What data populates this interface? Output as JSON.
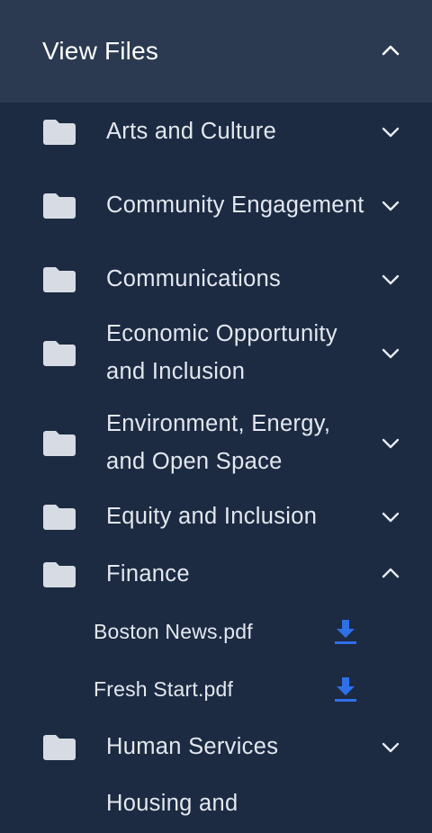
{
  "header": {
    "title": "View Files",
    "icon": "chevron-up-icon"
  },
  "folders": [
    {
      "label": "Arts and Culture",
      "expanded": false
    },
    {
      "label": "Community Engagement",
      "expanded": false
    },
    {
      "label": "Communications",
      "expanded": false
    },
    {
      "label": "Economic Opportunity and Inclusion",
      "expanded": false
    },
    {
      "label": "Environment, Energy, and Open Space",
      "expanded": false
    },
    {
      "label": "Equity and Inclusion",
      "expanded": false
    },
    {
      "label": "Finance",
      "expanded": true
    },
    {
      "label": "Human Services",
      "expanded": false
    },
    {
      "label": "Housing and",
      "expanded": false
    }
  ],
  "finance_files": [
    {
      "label": "Boston News.pdf",
      "icon": "download-icon"
    },
    {
      "label": "Fresh Start.pdf",
      "icon": "download-icon"
    }
  ],
  "colors": {
    "background": "#1c2a42",
    "header_background": "#2b3a51",
    "folder_icon": "#d7dce4",
    "download_icon": "#2f6fe8",
    "text": "#e3e8ef"
  }
}
